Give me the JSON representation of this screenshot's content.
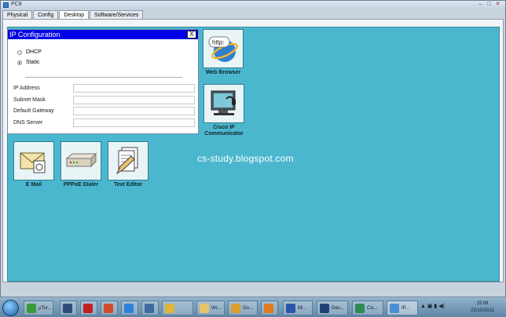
{
  "window": {
    "title": "PC8",
    "minimize": "–",
    "maximize": "□",
    "close": "✕"
  },
  "tabs": [
    {
      "label": "Physical"
    },
    {
      "label": "Config"
    },
    {
      "label": "Desktop"
    },
    {
      "label": "Software/Services"
    }
  ],
  "ip_dialog": {
    "title": "IP Configuration",
    "close_label": "X",
    "modes": [
      {
        "label": "DHCP",
        "selected": false
      },
      {
        "label": "Static",
        "selected": true
      }
    ],
    "fields": [
      {
        "label": "IP Address",
        "value": ""
      },
      {
        "label": "Subnet Mask",
        "value": ""
      },
      {
        "label": "Default Gateway",
        "value": ""
      },
      {
        "label": "DNS Server",
        "value": ""
      }
    ]
  },
  "desktop_icons": {
    "web_browser": {
      "label": "Web Browser",
      "icon_text": "http:"
    },
    "cisco_ip": {
      "label": "Cisco IP Communicator"
    },
    "email": {
      "label": "E Mail"
    },
    "pppoe": {
      "label": "PPPoE Dialer"
    },
    "text_editor": {
      "label": "Text Editor"
    }
  },
  "watermark": "cs-study.blogspot.com",
  "taskbar": {
    "items": [
      {
        "label": "µTor..."
      },
      {
        "label": ""
      },
      {
        "label": ""
      },
      {
        "label": ""
      },
      {
        "label": ""
      },
      {
        "label": ""
      },
      {
        "label": ""
      },
      {
        "label": "Wi..."
      },
      {
        "label": "Go..."
      },
      {
        "label": ""
      },
      {
        "label": "Mi..."
      },
      {
        "label": "Dev..."
      },
      {
        "label": "Cis..."
      },
      {
        "label": "IP..."
      }
    ],
    "clock_time": "15:08",
    "clock_date": "22/10/2012"
  },
  "colors": {
    "desktop": "#4bb7cf",
    "dialog_title": "#0000e6"
  }
}
